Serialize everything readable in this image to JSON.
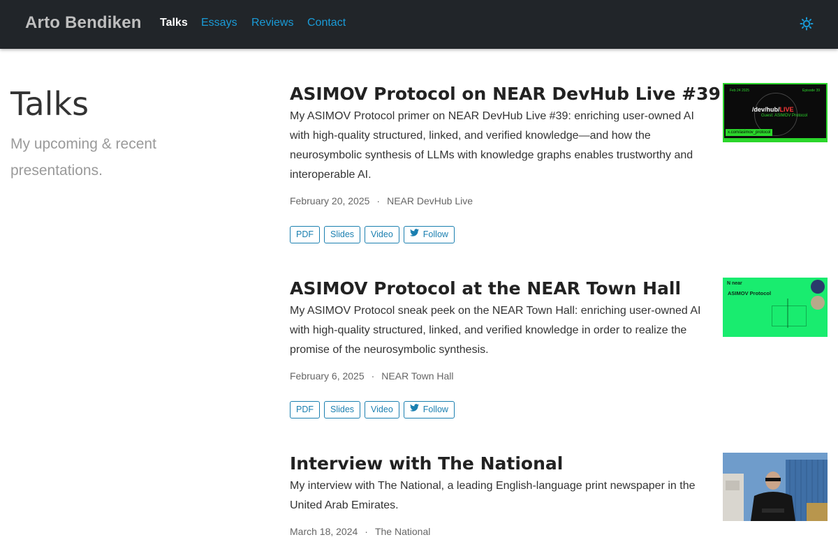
{
  "nav": {
    "brand": "Arto Bendiken",
    "links": [
      {
        "label": "Talks",
        "active": true
      },
      {
        "label": "Essays",
        "active": false
      },
      {
        "label": "Reviews",
        "active": false
      },
      {
        "label": "Contact",
        "active": false
      }
    ],
    "theme_icon": "sun-icon"
  },
  "header": {
    "title": "Talks",
    "subtitle": "My upcoming & recent presentations."
  },
  "talks": [
    {
      "title": "ASIMOV Protocol on NEAR DevHub Live #39",
      "description": "My ASIMOV Protocol primer on NEAR DevHub Live #39: enriching user-owned AI with high-quality structured, linked, and verified knowledge—and how the neurosymbolic synthesis of LLMs with knowledge graphs enables trustworthy and interoperable AI.",
      "date": "February 20, 2025",
      "sep": "·",
      "venue": "NEAR DevHub Live",
      "buttons": {
        "pdf": "PDF",
        "slides": "Slides",
        "video": "Video",
        "follow": "Follow"
      },
      "thumbnail": {
        "logo_left": "/dev/hub/",
        "logo_live": "LIVE",
        "guest": "Guest: ASIMOV Protocol",
        "tag": "x.com/asimov_protocol",
        "date_corner": "Feb 24 2025",
        "episode": "Episode 39"
      }
    },
    {
      "title": "ASIMOV Protocol at the NEAR Town Hall",
      "description": "My ASIMOV Protocol sneak peek on the NEAR Town Hall: enriching user-owned AI with high-quality structured, linked, and verified knowledge in order to realize the promise of the neurosymbolic synthesis.",
      "date": "February 6, 2025",
      "sep": "·",
      "venue": "NEAR Town Hall",
      "buttons": {
        "pdf": "PDF",
        "slides": "Slides",
        "video": "Video",
        "follow": "Follow"
      },
      "thumbnail": {
        "logo": "N near",
        "slide_title": "ASIMOV Protocol"
      }
    },
    {
      "title": "Interview with The National",
      "description": "My interview with The National, a leading English-language print newspaper in the United Arab Emirates.",
      "date": "March 18, 2024",
      "sep": "·",
      "venue": "The National"
    }
  ],
  "colors": {
    "navbar_bg": "#212529",
    "link": "#1a9bd7",
    "button_border": "#1a7fb0",
    "thumb_green": "#19ec6f"
  }
}
